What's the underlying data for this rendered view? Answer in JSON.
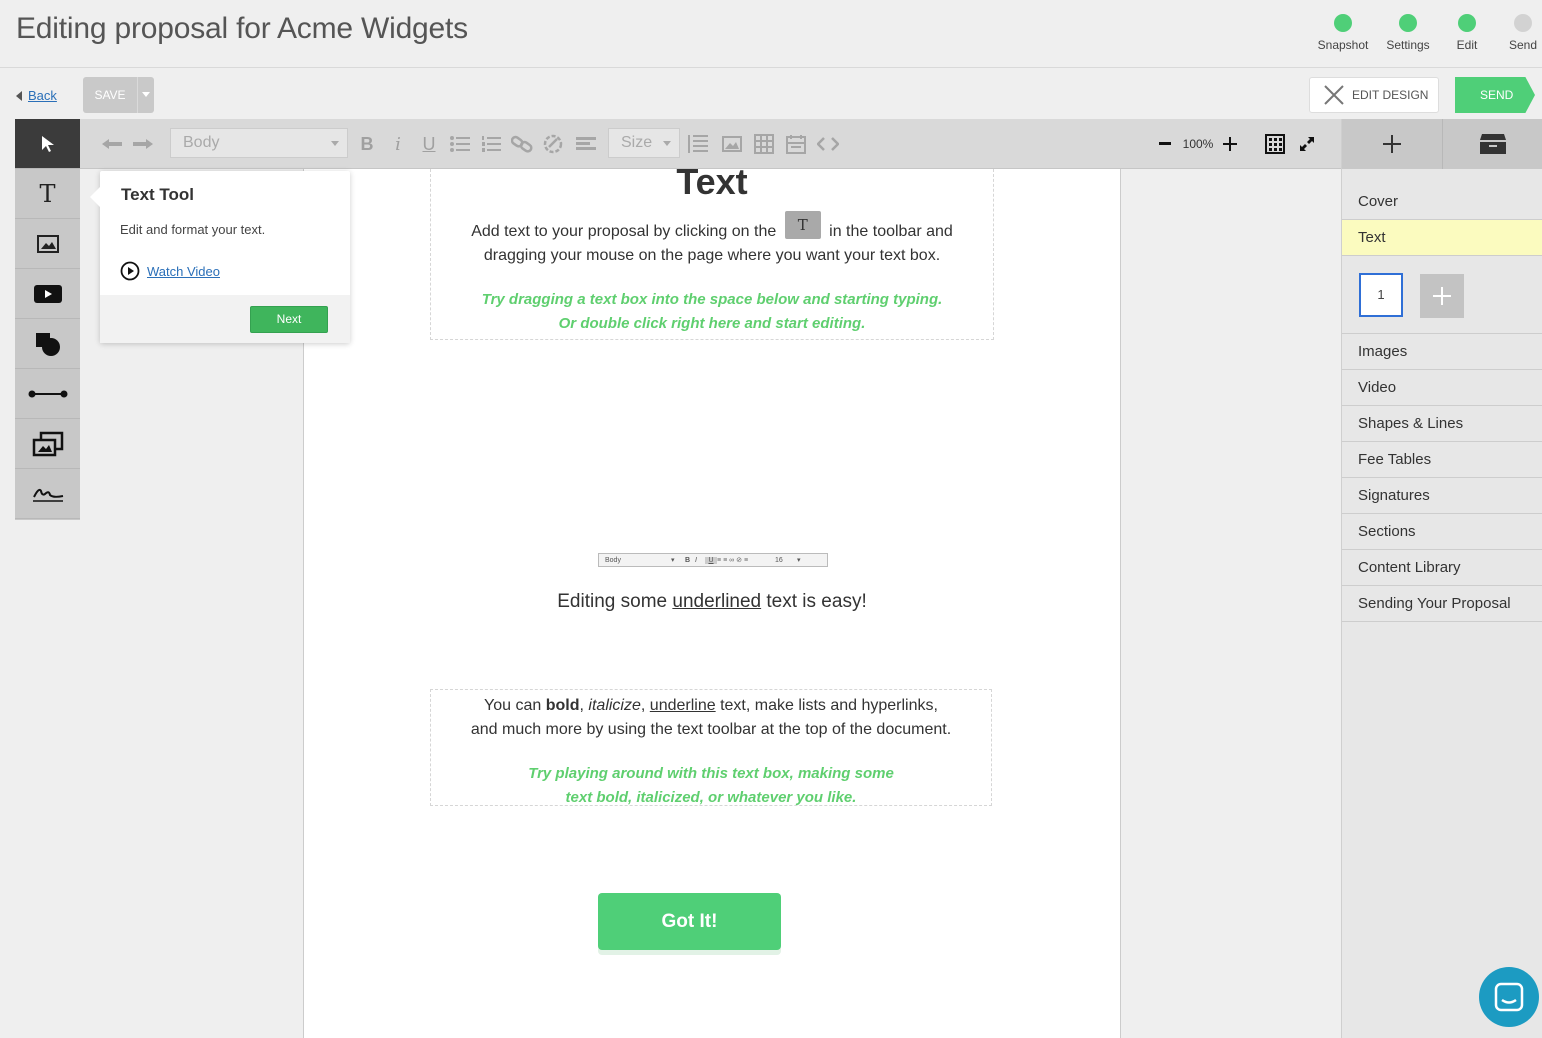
{
  "header": {
    "title": "Editing proposal for Acme Widgets",
    "steps": [
      {
        "label": "Snapshot",
        "state": "complete"
      },
      {
        "label": "Settings",
        "state": "complete"
      },
      {
        "label": "Edit",
        "state": "complete"
      },
      {
        "label": "Send",
        "state": "incomplete"
      }
    ]
  },
  "topbar": {
    "back_label": "Back",
    "save_label": "SAVE",
    "edit_design_label": "EDIT DESIGN",
    "send_label": "SEND"
  },
  "tools": [
    "pointer-icon",
    "text-tool-icon",
    "image-icon",
    "video-icon",
    "shapes-icon",
    "line-icon",
    "gallery-icon",
    "signature-icon"
  ],
  "format_toolbar": {
    "style_select": "Body",
    "size_select": "Size",
    "zoom": "100%"
  },
  "popover": {
    "title": "Text Tool",
    "body": "Edit and format your text.",
    "video_link": "Watch Video",
    "next_label": "Next"
  },
  "document": {
    "heading": "Text",
    "intro_before_icon": "Add text to your proposal by clicking on the",
    "intro_icon_glyph": "T",
    "intro_after_icon": "in the toolbar and",
    "intro_line2": "dragging your mouse on the page where you want your text box.",
    "tip1_line1": "Try dragging a text box into the space below and starting typing.",
    "tip1_line2": "Or double click right here and start editing.",
    "mini_toolbar": {
      "style": "Body",
      "size": "16"
    },
    "underline_demo": {
      "before": "Editing some",
      "underlined": "underlined",
      "after": "text is easy!"
    },
    "para2": {
      "p1": "You can",
      "bold": "bold",
      "sep1": ",",
      "italic": "italicize",
      "sep2": ",",
      "underline": "underline",
      "p2": "text, make lists and hyperlinks,",
      "line2": "and much more by using the text toolbar at the top of the document."
    },
    "tip2_line1": "Try playing around with this text box, making some",
    "tip2_line2": "text bold, italicized, or whatever you like.",
    "got_it": "Got It!"
  },
  "right_panel": {
    "sections_top": [
      "Cover",
      "Text"
    ],
    "selected": "Text",
    "page_thumb": "1",
    "sections_bottom": [
      "Images",
      "Video",
      "Shapes & Lines",
      "Fee Tables",
      "Signatures",
      "Sections",
      "Content Library",
      "Sending Your Proposal"
    ]
  },
  "colors": {
    "accent_green": "#4fcf78",
    "tip_green": "#5fcf6f",
    "selected_row": "#fbfbbf",
    "chat": "#1c9bc2"
  }
}
